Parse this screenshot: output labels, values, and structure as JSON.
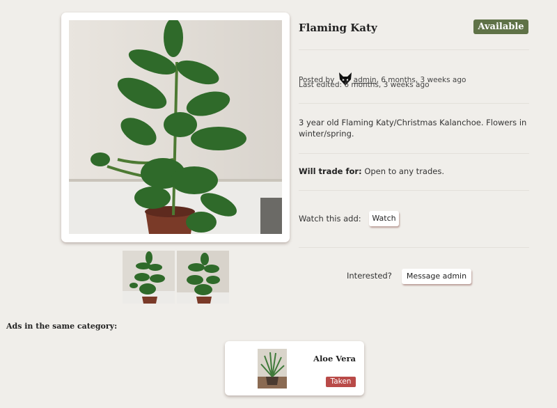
{
  "listing": {
    "title": "Flaming Katy",
    "status": "Available",
    "posted_by_prefix": "Posted by",
    "author": "admin",
    "posted_ago": ", 6 months, 3 weeks ago",
    "last_edited": "Last edited: 6 months, 3 weeks ago",
    "description": "3 year old Flaming Katy/Christmas Kalanchoe. Flowers in winter/spring.",
    "trade_label": "Will trade for:",
    "trade_value": "Open to any trades.",
    "watch_label": "Watch this add:",
    "watch_button": "Watch",
    "interested_label": "Interested?",
    "message_button": "Message admin",
    "colors": {
      "available": "#5f7247",
      "taken": "#b94a48"
    }
  },
  "related": {
    "heading": "Ads in the same category:",
    "items": [
      {
        "title": "Aloe Vera",
        "status": "Taken"
      }
    ]
  }
}
